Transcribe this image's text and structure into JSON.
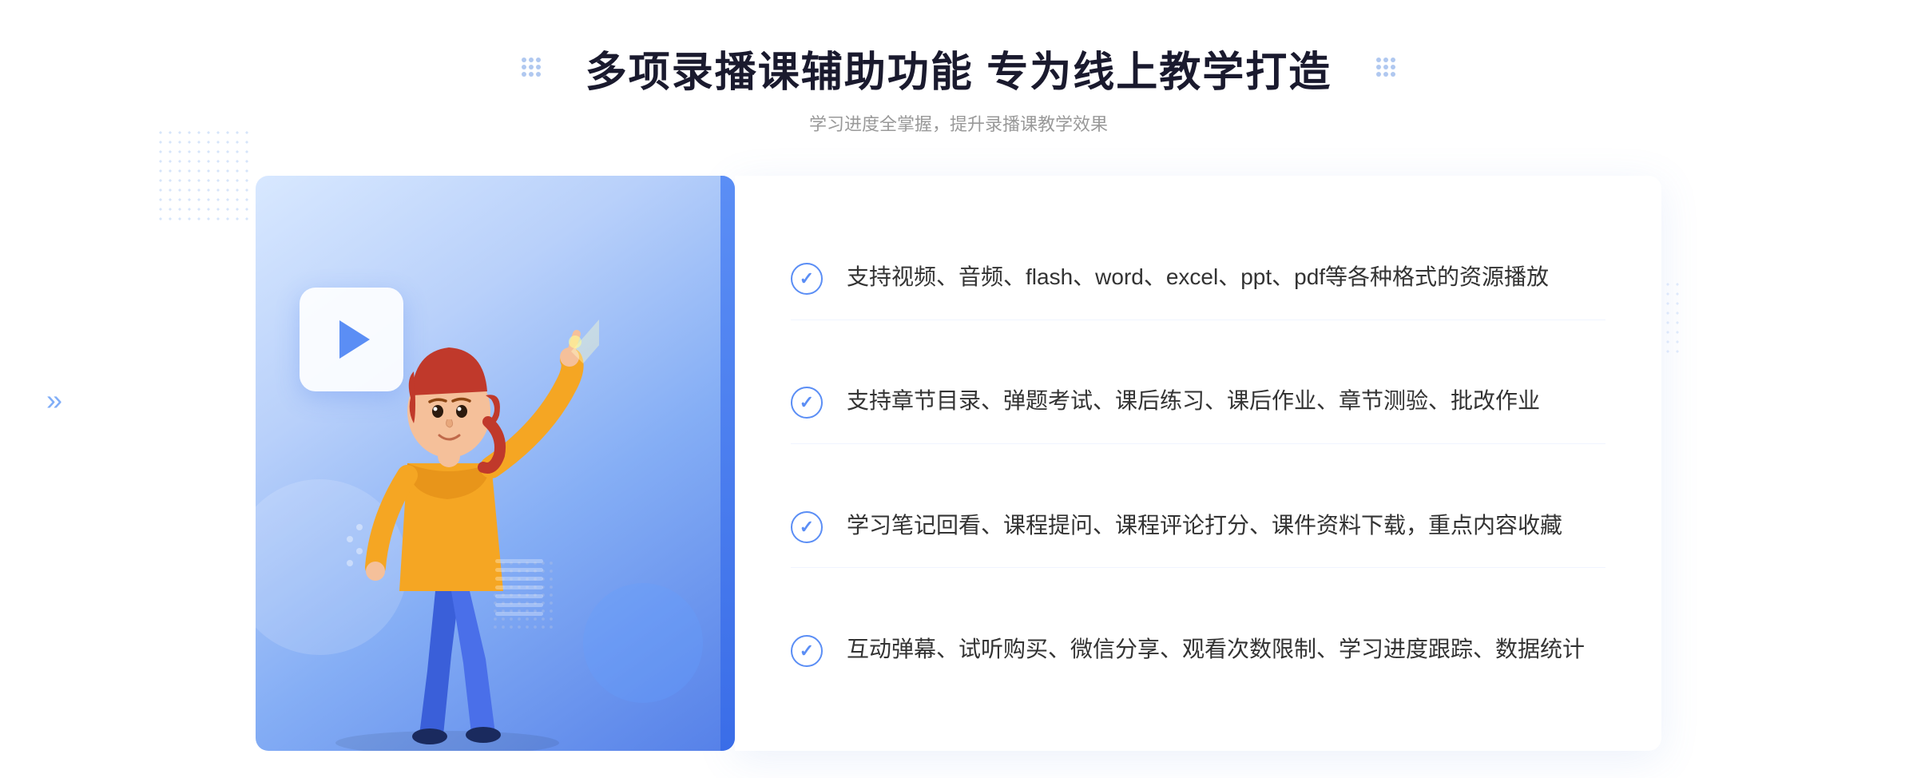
{
  "header": {
    "main_title": "多项录播课辅助功能 专为线上教学打造",
    "sub_title": "学习进度全掌握，提升录播课教学效果"
  },
  "features": [
    {
      "id": 1,
      "text": "支持视频、音频、flash、word、excel、ppt、pdf等各种格式的资源播放"
    },
    {
      "id": 2,
      "text": "支持章节目录、弹题考试、课后练习、课后作业、章节测验、批改作业"
    },
    {
      "id": 3,
      "text": "学习笔记回看、课程提问、课程评论打分、课件资料下载，重点内容收藏"
    },
    {
      "id": 4,
      "text": "互动弹幕、试听购买、微信分享、观看次数限制、学习进度跟踪、数据统计"
    }
  ],
  "icons": {
    "check": "✓",
    "chevron_left": "»",
    "play": "▶"
  },
  "colors": {
    "accent": "#5b8ef5",
    "title": "#1a1a2e",
    "subtitle": "#999999",
    "text": "#333333",
    "border": "#f0f4ff"
  }
}
